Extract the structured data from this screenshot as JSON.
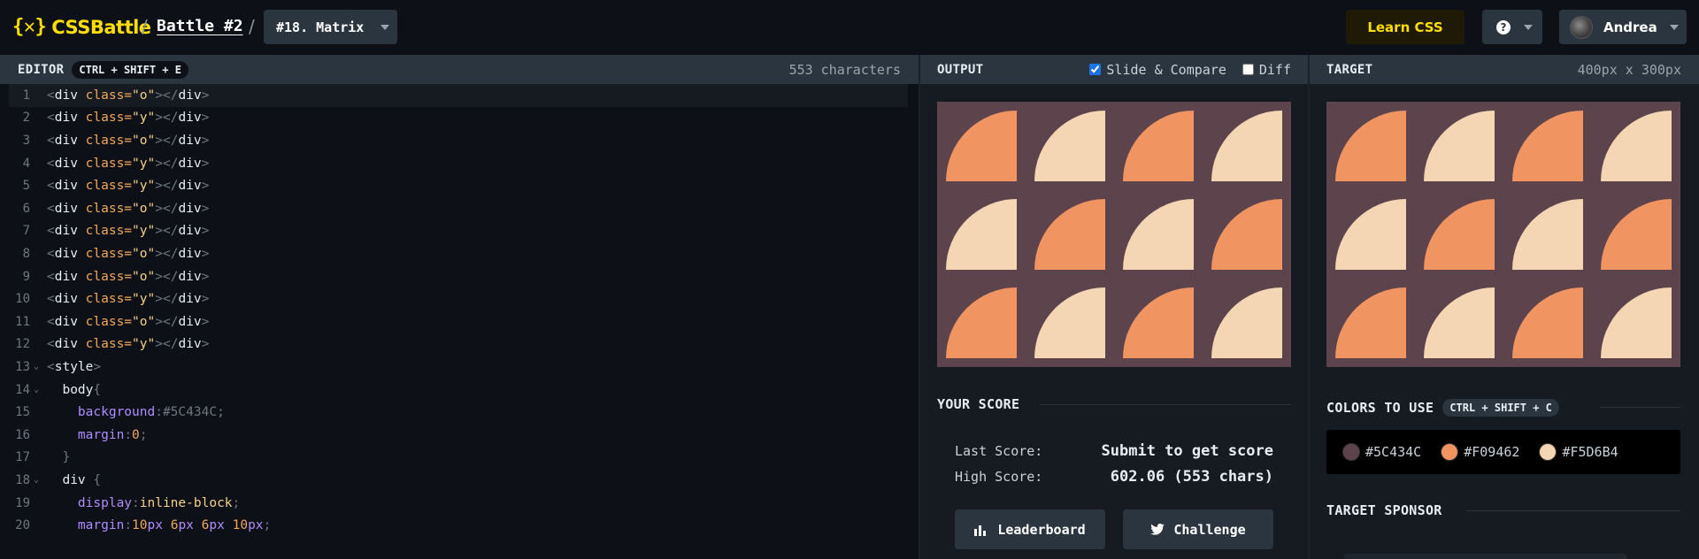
{
  "header": {
    "logo_mark": "{✕}",
    "logo_text": "CSSBattle",
    "sep1": "/",
    "battle": "Battle #2",
    "sep2": "/",
    "level": "#18. Matrix",
    "learn_css": "Learn CSS",
    "help_glyph": "?",
    "user": "Andrea"
  },
  "editor": {
    "title": "EDITOR",
    "shortcut": "CTRL + SHIFT + E",
    "char_count": "553 characters",
    "lines": [
      {
        "n": "1",
        "fold": "",
        "tokens": [
          [
            "punc",
            "<"
          ],
          [
            "tag",
            "div "
          ],
          [
            "attr",
            "class="
          ],
          [
            "val",
            "\"o\""
          ],
          [
            "punc",
            "></"
          ],
          [
            "tag",
            "div"
          ],
          [
            "punc",
            ">"
          ]
        ]
      },
      {
        "n": "2",
        "fold": "",
        "tokens": [
          [
            "punc",
            "<"
          ],
          [
            "tag",
            "div "
          ],
          [
            "attr",
            "class="
          ],
          [
            "val",
            "\"y\""
          ],
          [
            "punc",
            "></"
          ],
          [
            "tag",
            "div"
          ],
          [
            "punc",
            ">"
          ]
        ]
      },
      {
        "n": "3",
        "fold": "",
        "tokens": [
          [
            "punc",
            "<"
          ],
          [
            "tag",
            "div "
          ],
          [
            "attr",
            "class="
          ],
          [
            "val",
            "\"o\""
          ],
          [
            "punc",
            "></"
          ],
          [
            "tag",
            "div"
          ],
          [
            "punc",
            ">"
          ]
        ]
      },
      {
        "n": "4",
        "fold": "",
        "tokens": [
          [
            "punc",
            "<"
          ],
          [
            "tag",
            "div "
          ],
          [
            "attr",
            "class="
          ],
          [
            "val",
            "\"y\""
          ],
          [
            "punc",
            "></"
          ],
          [
            "tag",
            "div"
          ],
          [
            "punc",
            ">"
          ]
        ]
      },
      {
        "n": "5",
        "fold": "",
        "tokens": [
          [
            "punc",
            "<"
          ],
          [
            "tag",
            "div "
          ],
          [
            "attr",
            "class="
          ],
          [
            "val",
            "\"y\""
          ],
          [
            "punc",
            "></"
          ],
          [
            "tag",
            "div"
          ],
          [
            "punc",
            ">"
          ]
        ]
      },
      {
        "n": "6",
        "fold": "",
        "tokens": [
          [
            "punc",
            "<"
          ],
          [
            "tag",
            "div "
          ],
          [
            "attr",
            "class="
          ],
          [
            "val",
            "\"o\""
          ],
          [
            "punc",
            "></"
          ],
          [
            "tag",
            "div"
          ],
          [
            "punc",
            ">"
          ]
        ]
      },
      {
        "n": "7",
        "fold": "",
        "tokens": [
          [
            "punc",
            "<"
          ],
          [
            "tag",
            "div "
          ],
          [
            "attr",
            "class="
          ],
          [
            "val",
            "\"y\""
          ],
          [
            "punc",
            "></"
          ],
          [
            "tag",
            "div"
          ],
          [
            "punc",
            ">"
          ]
        ]
      },
      {
        "n": "8",
        "fold": "",
        "tokens": [
          [
            "punc",
            "<"
          ],
          [
            "tag",
            "div "
          ],
          [
            "attr",
            "class="
          ],
          [
            "val",
            "\"o\""
          ],
          [
            "punc",
            "></"
          ],
          [
            "tag",
            "div"
          ],
          [
            "punc",
            ">"
          ]
        ]
      },
      {
        "n": "9",
        "fold": "",
        "tokens": [
          [
            "punc",
            "<"
          ],
          [
            "tag",
            "div "
          ],
          [
            "attr",
            "class="
          ],
          [
            "val",
            "\"o\""
          ],
          [
            "punc",
            "></"
          ],
          [
            "tag",
            "div"
          ],
          [
            "punc",
            ">"
          ]
        ]
      },
      {
        "n": "10",
        "fold": "",
        "tokens": [
          [
            "punc",
            "<"
          ],
          [
            "tag",
            "div "
          ],
          [
            "attr",
            "class="
          ],
          [
            "val",
            "\"y\""
          ],
          [
            "punc",
            "></"
          ],
          [
            "tag",
            "div"
          ],
          [
            "punc",
            ">"
          ]
        ]
      },
      {
        "n": "11",
        "fold": "",
        "tokens": [
          [
            "punc",
            "<"
          ],
          [
            "tag",
            "div "
          ],
          [
            "attr",
            "class="
          ],
          [
            "val",
            "\"o\""
          ],
          [
            "punc",
            "></"
          ],
          [
            "tag",
            "div"
          ],
          [
            "punc",
            ">"
          ]
        ]
      },
      {
        "n": "12",
        "fold": "",
        "tokens": [
          [
            "punc",
            "<"
          ],
          [
            "tag",
            "div "
          ],
          [
            "attr",
            "class="
          ],
          [
            "val",
            "\"y\""
          ],
          [
            "punc",
            "></"
          ],
          [
            "tag",
            "div"
          ],
          [
            "punc",
            ">"
          ]
        ]
      },
      {
        "n": "13",
        "fold": "⌄",
        "tokens": [
          [
            "punc",
            "<"
          ],
          [
            "tag",
            "style"
          ],
          [
            "punc",
            ">"
          ]
        ]
      },
      {
        "n": "14",
        "fold": "⌄",
        "tokens": [
          [
            "sel",
            "  body"
          ],
          [
            "punc",
            "{"
          ]
        ]
      },
      {
        "n": "15",
        "fold": "",
        "tokens": [
          [
            "prop",
            "    background"
          ],
          [
            "punc",
            ":"
          ],
          [
            "punc",
            "#5C434C"
          ],
          [
            "punc",
            ";"
          ]
        ]
      },
      {
        "n": "16",
        "fold": "",
        "tokens": [
          [
            "prop",
            "    margin"
          ],
          [
            "punc",
            ":"
          ],
          [
            "num",
            "0"
          ],
          [
            "punc",
            ";"
          ]
        ]
      },
      {
        "n": "17",
        "fold": "",
        "tokens": [
          [
            "punc",
            "  }"
          ]
        ]
      },
      {
        "n": "18",
        "fold": "⌄",
        "tokens": [
          [
            "sel",
            "  div "
          ],
          [
            "punc",
            "{"
          ]
        ]
      },
      {
        "n": "19",
        "fold": "",
        "tokens": [
          [
            "prop",
            "    display"
          ],
          [
            "punc",
            ":"
          ],
          [
            "val",
            "inline-block"
          ],
          [
            "punc",
            ";"
          ]
        ]
      },
      {
        "n": "20",
        "fold": "",
        "tokens": [
          [
            "prop",
            "    margin"
          ],
          [
            "punc",
            ":"
          ],
          [
            "num",
            "10"
          ],
          [
            "prop",
            "px "
          ],
          [
            "num",
            "6"
          ],
          [
            "prop",
            "px "
          ],
          [
            "num",
            "6"
          ],
          [
            "prop",
            "px "
          ],
          [
            "num",
            "10"
          ],
          [
            "prop",
            "px"
          ],
          [
            "punc",
            ";"
          ]
        ]
      }
    ]
  },
  "output": {
    "title": "OUTPUT",
    "slide_compare": "Slide & Compare",
    "slide_checked": true,
    "diff": "Diff",
    "diff_checked": false,
    "pattern": [
      "o",
      "y",
      "o",
      "y",
      "y",
      "o",
      "y",
      "o",
      "o",
      "y",
      "o",
      "y"
    ]
  },
  "score": {
    "title": "YOUR SCORE",
    "last_label": "Last Score:",
    "last_value": "Submit to get score",
    "high_label": "High Score:",
    "high_value": "602.06 (553 chars)",
    "leaderboard": "Leaderboard",
    "challenge": "Challenge"
  },
  "target": {
    "title": "TARGET",
    "size": "400px x 300px",
    "pattern": [
      "o",
      "y",
      "o",
      "y",
      "y",
      "o",
      "y",
      "o",
      "o",
      "y",
      "o",
      "y"
    ]
  },
  "colors": {
    "title": "COLORS TO USE",
    "shortcut": "CTRL + SHIFT + C",
    "items": [
      {
        "hex": "#5C434C",
        "color": "#5C434C"
      },
      {
        "hex": "#F09462",
        "color": "#F09462"
      },
      {
        "hex": "#F5D6B4",
        "color": "#F5D6B4"
      }
    ]
  },
  "sponsor": {
    "title": "TARGET SPONSOR"
  }
}
